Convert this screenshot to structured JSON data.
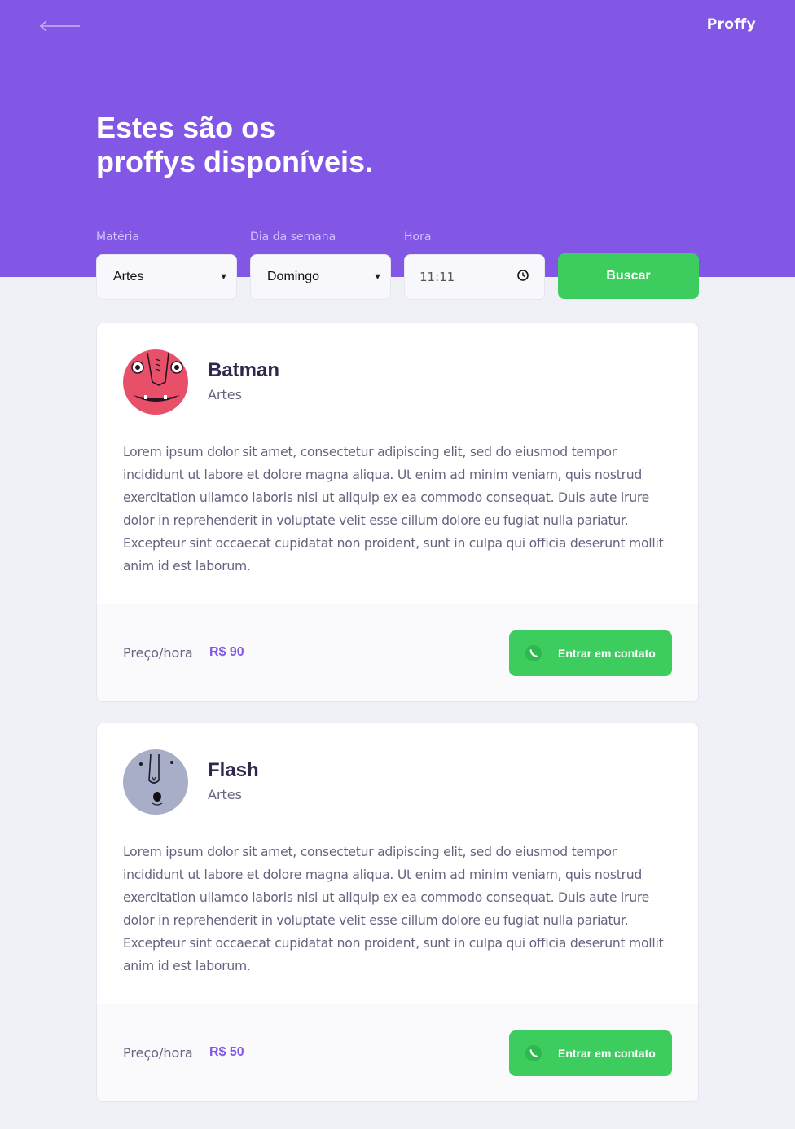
{
  "header": {
    "logo": "Proffy",
    "title_line1": "Estes são os",
    "title_line2": "proffys disponíveis."
  },
  "filters": {
    "subject_label": "Matéria",
    "subject_value": "Artes",
    "weekday_label": "Dia da semana",
    "weekday_value": "Domingo",
    "time_label": "Hora",
    "time_value": "11:11",
    "search_button": "Buscar"
  },
  "colors": {
    "primary": "#8257E5",
    "secondary": "#3DCC5E",
    "background": "#F0F0F7"
  },
  "teachers": [
    {
      "name": "Batman",
      "subject": "Artes",
      "bio": "Lorem ipsum dolor sit amet, consectetur adipiscing elit, sed do eiusmod tempor incididunt ut labore et dolore magna aliqua. Ut enim ad minim veniam, quis nostrud exercitation ullamco laboris nisi ut aliquip ex ea commodo consequat. Duis aute irure dolor in reprehenderit in voluptate velit esse cillum dolore eu fugiat nulla pariatur. Excepteur sint occaecat cupidatat non proident, sunt in culpa qui officia deserunt mollit anim id est laborum.",
      "price_label": "Preço/hora",
      "price": "R$ 90",
      "contact_button": "Entrar em contato",
      "avatar_color": "#E8506A"
    },
    {
      "name": "Flash",
      "subject": "Artes",
      "bio": "Lorem ipsum dolor sit amet, consectetur adipiscing elit, sed do eiusmod tempor incididunt ut labore et dolore magna aliqua. Ut enim ad minim veniam, quis nostrud exercitation ullamco laboris nisi ut aliquip ex ea commodo consequat. Duis aute irure dolor in reprehenderit in voluptate velit esse cillum dolore eu fugiat nulla pariatur. Excepteur sint occaecat cupidatat non proident, sunt in culpa qui officia deserunt mollit anim id est laborum.",
      "price_label": "Preço/hora",
      "price": "R$ 50",
      "contact_button": "Entrar em contato",
      "avatar_color": "#A8ADC8"
    }
  ]
}
